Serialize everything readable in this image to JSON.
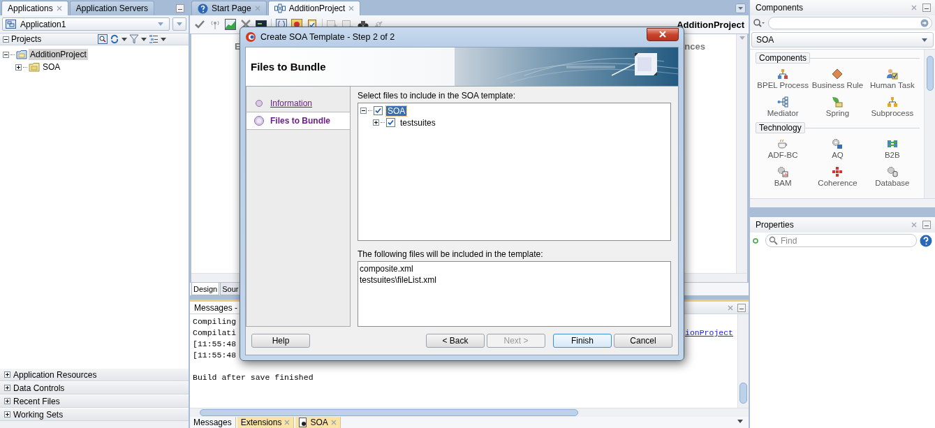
{
  "left_panel": {
    "tabs": [
      {
        "label": "Applications",
        "selected": true
      },
      {
        "label": "Application Servers",
        "selected": false
      }
    ],
    "application": "Application1",
    "projects_title": "Projects",
    "tree": [
      {
        "label": "AdditionProject",
        "expanded": true,
        "selected": true,
        "children": [
          {
            "label": "SOA",
            "expanded": false,
            "selected": false
          }
        ]
      }
    ],
    "sections": [
      {
        "label": "Application Resources",
        "expanded": false
      },
      {
        "label": "Data Controls",
        "expanded": false
      },
      {
        "label": "Recent Files",
        "expanded": false
      },
      {
        "label": "Working Sets",
        "expanded": false
      }
    ]
  },
  "editor": {
    "tabs": [
      {
        "label": "Start Page",
        "selected": false,
        "kind": "help"
      },
      {
        "label": "AdditionProject",
        "selected": true,
        "kind": "composite"
      }
    ],
    "title": "AdditionProject",
    "canvas_texts": [
      "E",
      "nces"
    ],
    "view_tabs": [
      {
        "label": "Design",
        "selected": true
      },
      {
        "label": "Sour",
        "selected": false
      }
    ]
  },
  "messages": {
    "title": "Messages -",
    "lines": [
      {
        "text": "Compiling"
      },
      {
        "text": "Compilati",
        "link": "ionProject"
      },
      {
        "text": "[11:55:48"
      },
      {
        "text": "[11:55:48"
      }
    ],
    "summary": "Build after save finished",
    "tabs": [
      {
        "label": "Messages",
        "selected": true,
        "kind": "plain"
      },
      {
        "label": "Extensions",
        "selected": false,
        "kind": "closable"
      },
      {
        "label": "SOA",
        "selected": false,
        "kind": "document"
      }
    ]
  },
  "components_panel": {
    "title": "Components",
    "category": "SOA",
    "groups": [
      {
        "title": "Components",
        "items": [
          {
            "label": "BPEL Process",
            "kind": "bpel"
          },
          {
            "label": "Business Rule",
            "kind": "rule"
          },
          {
            "label": "Human Task",
            "kind": "task"
          },
          {
            "label": "Mediator",
            "kind": "mediator"
          },
          {
            "label": "Spring",
            "kind": "spring"
          },
          {
            "label": "Subprocess",
            "kind": "subprocess"
          }
        ]
      },
      {
        "title": "Technology",
        "items": [
          {
            "label": "ADF-BC",
            "kind": "adfbc"
          },
          {
            "label": "AQ",
            "kind": "aq"
          },
          {
            "label": "B2B",
            "kind": "b2b"
          },
          {
            "label": "BAM",
            "kind": "bam"
          },
          {
            "label": "Coherence",
            "kind": "coherence"
          },
          {
            "label": "Database",
            "kind": "database"
          }
        ]
      }
    ]
  },
  "properties_panel": {
    "title": "Properties",
    "search": {
      "placeholder": "Find"
    }
  },
  "dialog": {
    "title": "Create SOA Template - Step 2 of 2",
    "heading": "Files to Bundle",
    "steps": [
      {
        "label": "Information",
        "selected": false
      },
      {
        "label": "Files to Bundle",
        "selected": true
      }
    ],
    "select_label": "Select files to include in the SOA template:",
    "tree": [
      {
        "label": "SOA",
        "checked": true,
        "expanded": true,
        "selected": true,
        "children": [
          {
            "label": "testsuites",
            "checked": true,
            "expanded": false,
            "selected": false
          }
        ]
      }
    ],
    "files_label": "The following files will be included in the template:",
    "files": [
      "composite.xml",
      "testsuites\\fileList.xml"
    ],
    "buttons": [
      {
        "label": "Help",
        "kind": "help",
        "disabled": false,
        "default": false
      },
      {
        "label": "< Back",
        "kind": "nav",
        "disabled": false,
        "default": false
      },
      {
        "label": "Next >",
        "kind": "nav",
        "disabled": true,
        "default": false
      },
      {
        "label": "Finish",
        "kind": "action",
        "disabled": false,
        "default": true
      },
      {
        "label": "Cancel",
        "kind": "action",
        "disabled": false,
        "default": false
      }
    ]
  }
}
